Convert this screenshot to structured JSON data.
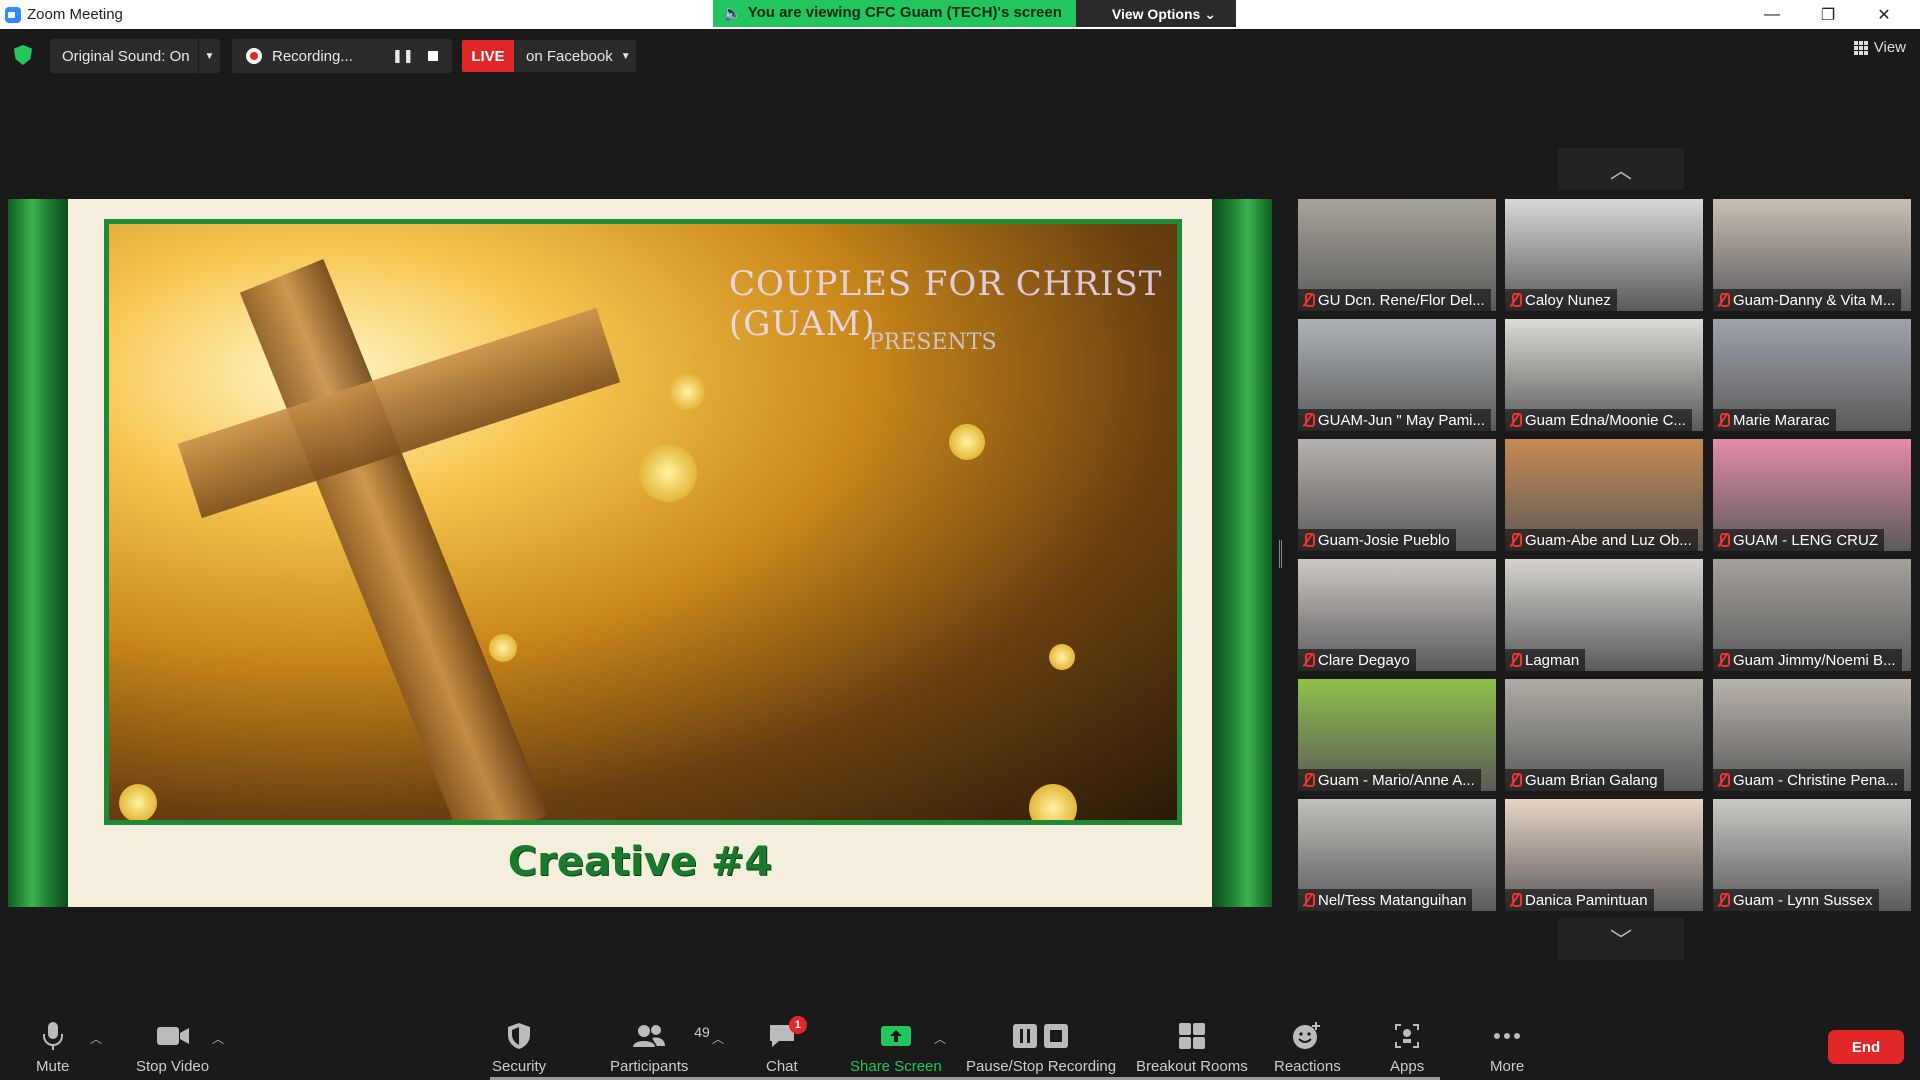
{
  "window": {
    "title": "Zoom Meeting",
    "minimize": "—",
    "restore": "❐",
    "close": "✕"
  },
  "share_banner": {
    "message": "You are viewing CFC Guam (TECH)'s screen",
    "view_options": "View Options ⌄"
  },
  "topbar": {
    "original_sound": "Original Sound: On",
    "recording_status": "Recording...",
    "live_badge": "LIVE",
    "live_target": "on Facebook",
    "view_label": "View"
  },
  "shared_content": {
    "logo_text": "COUPLES FOR CHRIST (GUAM)",
    "presents": "PRESENTS",
    "caption": "Creative #4"
  },
  "participants": [
    {
      "name": "GU Dcn. Rene/Flor Del...",
      "bg": "#a8a39a"
    },
    {
      "name": "Caloy Nunez",
      "bg": "#d8d8d8"
    },
    {
      "name": "Guam-Danny & Vita M...",
      "bg": "#c9bfb4"
    },
    {
      "name": "GUAM-Jun \" May Pami...",
      "bg": "#aeb3b8"
    },
    {
      "name": "Guam Edna/Moonie C...",
      "bg": "#d9dcd5"
    },
    {
      "name": "Marie Mararac",
      "bg": "#9fa3ad"
    },
    {
      "name": "Guam-Josie Pueblo",
      "bg": "#b8b2ad"
    },
    {
      "name": "Guam-Abe and Luz Ob...",
      "bg": "#c78a52"
    },
    {
      "name": "GUAM - LENG CRUZ",
      "bg": "#e58ca8"
    },
    {
      "name": "Clare Degayo",
      "bg": "#cdc8c4"
    },
    {
      "name": "Lagman",
      "bg": "#d6d3cf"
    },
    {
      "name": "Guam Jimmy/Noemi B...",
      "bg": "#a5a19b"
    },
    {
      "name": "Guam - Mario/Anne A...",
      "bg": "#8fc04a"
    },
    {
      "name": "Guam Brian Galang",
      "bg": "#b0aca5"
    },
    {
      "name": "Guam - Christine Pena...",
      "bg": "#b9b3ab"
    },
    {
      "name": "Nel/Tess Matanguihan",
      "bg": "#c2c0bc"
    },
    {
      "name": "Danica Pamintuan",
      "bg": "#e9d4c6"
    },
    {
      "name": "Guam - Lynn Sussex",
      "bg": "#c9c9c6"
    }
  ],
  "toolbar": {
    "mute": "Mute",
    "stop_video": "Stop Video",
    "security": "Security",
    "participants": "Participants",
    "participants_count": "49",
    "chat": "Chat",
    "chat_badge": "1",
    "share_screen": "Share Screen",
    "pause_stop_recording": "Pause/Stop Recording",
    "breakout_rooms": "Breakout Rooms",
    "reactions": "Reactions",
    "apps": "Apps",
    "more": "More",
    "end": "End"
  },
  "colors": {
    "accent_green": "#22c55e",
    "live_red": "#e02828",
    "toolbar_bg": "#1a1a1a"
  }
}
